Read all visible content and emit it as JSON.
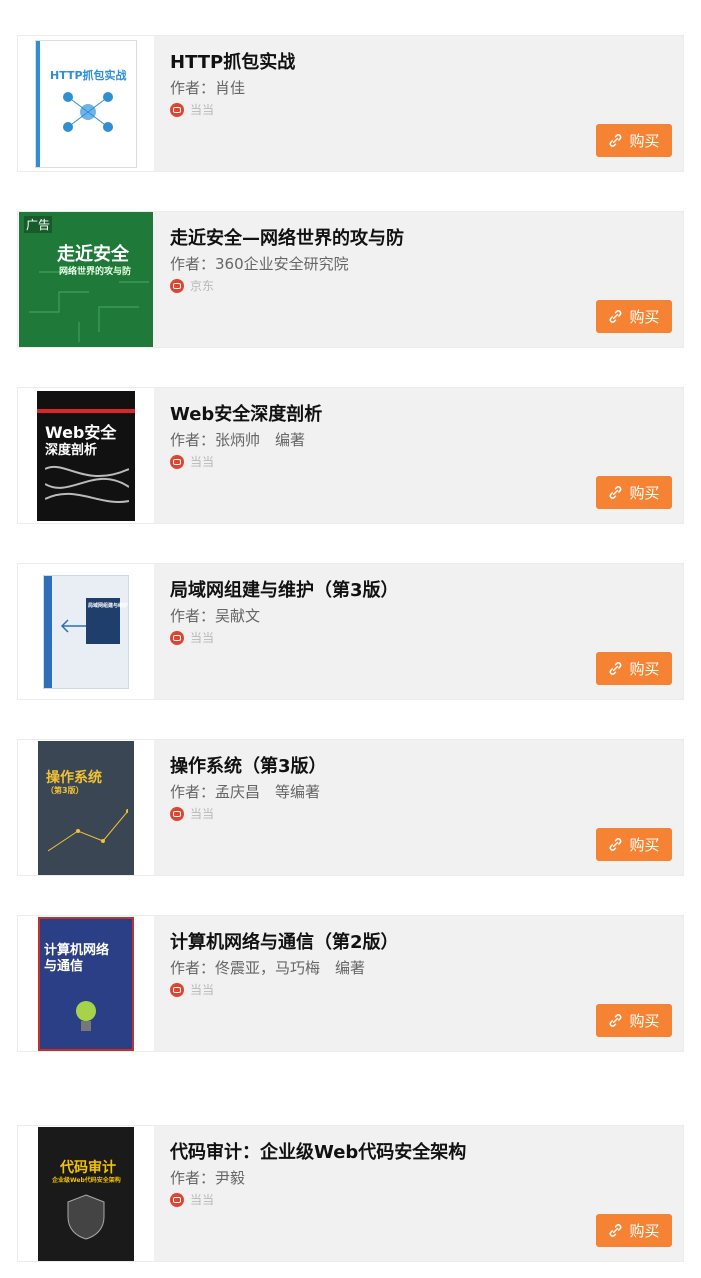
{
  "buy_label": "购买",
  "ad_label": "广告",
  "books": [
    {
      "title": "HTTP抓包实战",
      "author_label": "作者：",
      "author": "肖佳",
      "seller": "当当",
      "cover": {
        "bg": "#ffffff",
        "text": "HTTP抓包实战",
        "accent": "#2f8fd3"
      }
    },
    {
      "title": "走近安全—网络世界的攻与防",
      "author_label": "作者：",
      "author": "360企业安全研究院",
      "seller": "京东",
      "cover": {
        "bg": "#1f7a3a",
        "text": "走近安全",
        "sub": "网络世界的攻与防",
        "accent": "#ffffff"
      }
    },
    {
      "title": "Web安全深度剖析",
      "author_label": "作者：",
      "author": "张炳帅　编著",
      "seller": "当当",
      "cover": {
        "bg": "#111111",
        "text": "Web安全",
        "sub": "深度剖析",
        "accent": "#d62828"
      }
    },
    {
      "title": "局域网组建与维护（第3版）",
      "author_label": "作者：",
      "author": "吴献文",
      "seller": "当当",
      "cover": {
        "bg": "#e9eef5",
        "text": "局域网组建与维护",
        "accent": "#2d6fb8"
      }
    },
    {
      "title": "操作系统（第3版）",
      "author_label": "作者：",
      "author": "孟庆昌　等编著",
      "seller": "当当",
      "cover": {
        "bg": "#3b4654",
        "text": "操作系统",
        "sub": "（第3版）",
        "accent": "#f1c232"
      }
    },
    {
      "title": "计算机网络与通信（第2版）",
      "author_label": "作者：",
      "author": "佟震亚，马巧梅　编著",
      "seller": "当当",
      "cover": {
        "bg": "#2a3f86",
        "text": "计算机网络",
        "sub": "与通信",
        "accent": "#c4302b"
      }
    },
    {
      "title": "代码审计：企业级Web代码安全架构",
      "author_label": "作者：",
      "author": "尹毅",
      "seller": "当当",
      "cover": {
        "bg": "#1a1a1a",
        "text": "代码审计",
        "sub": "企业级Web代码安全架构",
        "accent": "#f2c200"
      }
    }
  ]
}
